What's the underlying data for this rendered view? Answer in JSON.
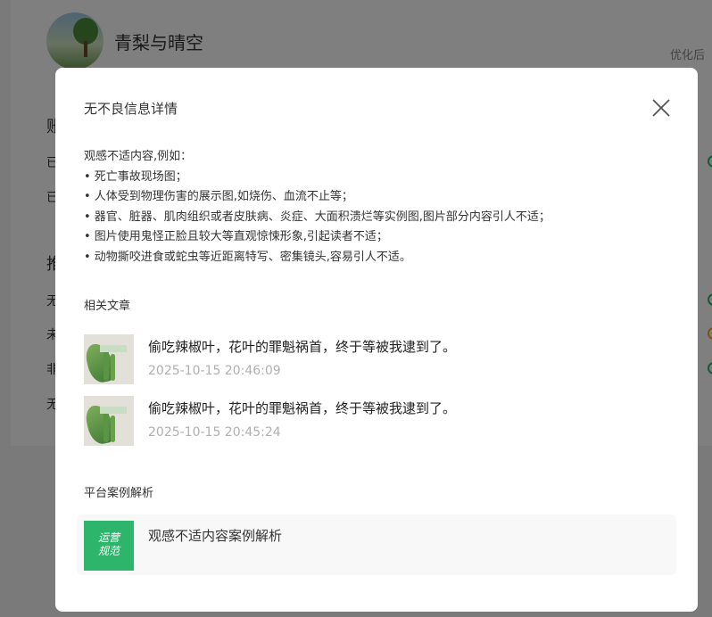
{
  "background": {
    "username": "青梨与晴空",
    "optimized_label": "优化后",
    "section_1_char": "账",
    "section_2_char": "推",
    "rows": [
      "已",
      "已",
      "无",
      "未",
      "非",
      "无"
    ]
  },
  "modal": {
    "title": "无不良信息详情",
    "description": {
      "intro": "观感不适内容,例如：",
      "items": [
        "• 死亡事故现场图；",
        "• 人体受到物理伤害的展示图,如烧伤、血流不止等；",
        "• 器官、脏器、肌肉组织或者皮肤病、炎症、大面积溃烂等实例图,图片部分内容引人不适；",
        "• 图片使用鬼怪正脸且较大等直观惊悚形象,引起读者不适；",
        "• 动物撕咬进食或蛇虫等近距离特写、密集镜头,容易引人不适。"
      ]
    },
    "related_label": "相关文章",
    "articles": [
      {
        "title": "偷吃辣椒叶，花叶的罪魁祸首，终于等被我逮到了。",
        "time": "2025-10-15 20:46:09"
      },
      {
        "title": "偷吃辣椒叶，花叶的罪魁祸首，终于等被我逮到了。",
        "time": "2025-10-15 20:45:24"
      }
    ],
    "case_label": "平台案例解析",
    "case": {
      "logo_line1": "运营",
      "logo_line2": "规范",
      "title": "观感不适内容案例解析"
    }
  },
  "colors": {
    "accent_green": "#2db56c",
    "overlay": "rgba(0,0,0,0.5)",
    "time_gray": "#b0b0b0"
  },
  "icons": {
    "close": "close-icon"
  }
}
